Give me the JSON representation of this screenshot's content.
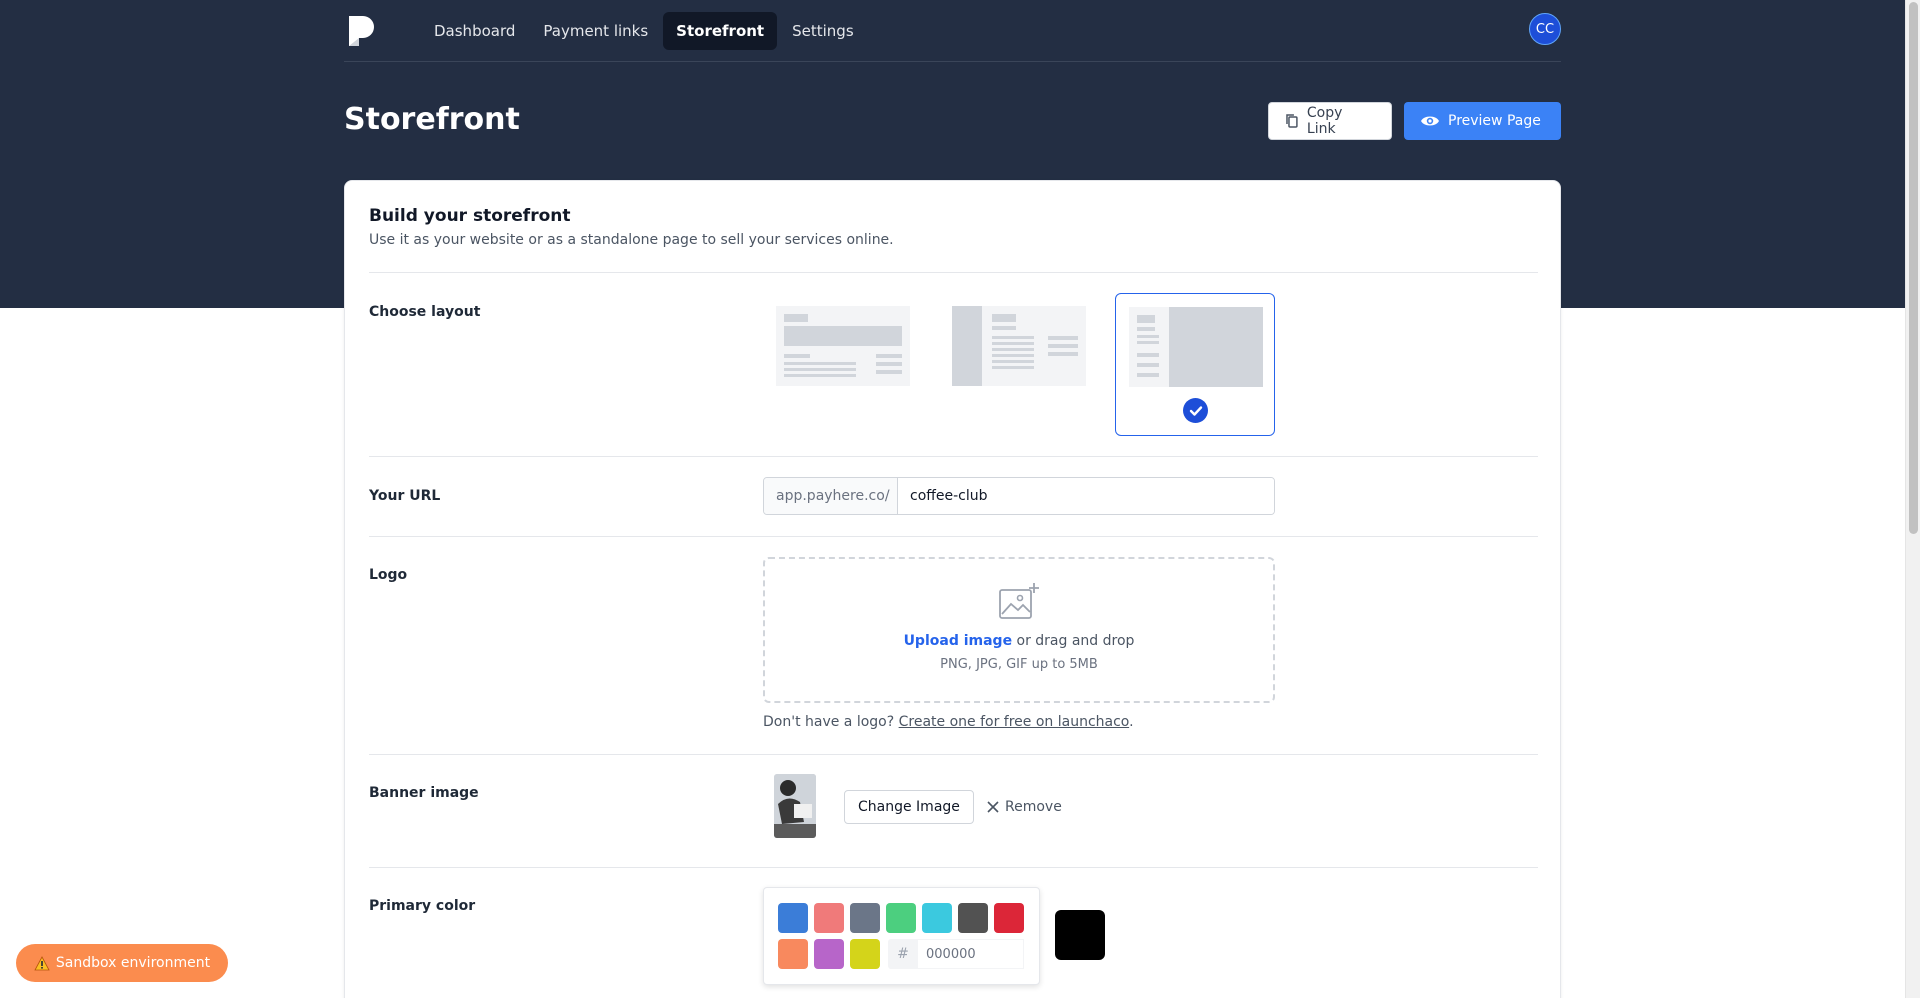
{
  "nav": {
    "items": [
      {
        "label": "Dashboard"
      },
      {
        "label": "Payment links"
      },
      {
        "label": "Storefront"
      },
      {
        "label": "Settings"
      }
    ],
    "active_index": 2,
    "avatar_initials": "CC"
  },
  "header": {
    "title": "Storefront",
    "copy_link_label": "Copy Link",
    "preview_label": "Preview Page"
  },
  "card": {
    "title": "Build your storefront",
    "subtitle": "Use it as your website or as a standalone page to sell your services online."
  },
  "layout": {
    "label": "Choose layout",
    "options": [
      "layout-banner",
      "layout-sidebar",
      "layout-split"
    ],
    "selected_index": 2
  },
  "url": {
    "label": "Your URL",
    "prefix": "app.payhere.co/",
    "value": "coffee-club"
  },
  "logo": {
    "label": "Logo",
    "upload_link": "Upload image",
    "upload_suffix": " or drag and drop",
    "formats": "PNG, JPG, GIF up to 5MB",
    "help_prefix": "Don't have a logo? ",
    "help_link": "Create one for free on launchaco",
    "help_suffix": "."
  },
  "banner": {
    "label": "Banner image",
    "change_label": "Change Image",
    "remove_label": "Remove"
  },
  "primary_color": {
    "label": "Primary color",
    "swatches": [
      "#3b7dd8",
      "#f07a7a",
      "#6b7688",
      "#4ccf7f",
      "#3bc9df",
      "#525252",
      "#dc2638",
      "#f8895e",
      "#b765c9",
      "#d4d41a"
    ],
    "hex_prefix": "#",
    "hex_value": "000000",
    "current": "#000000"
  },
  "sandbox": {
    "label": "Sandbox environment",
    "icon": "warning-icon"
  }
}
